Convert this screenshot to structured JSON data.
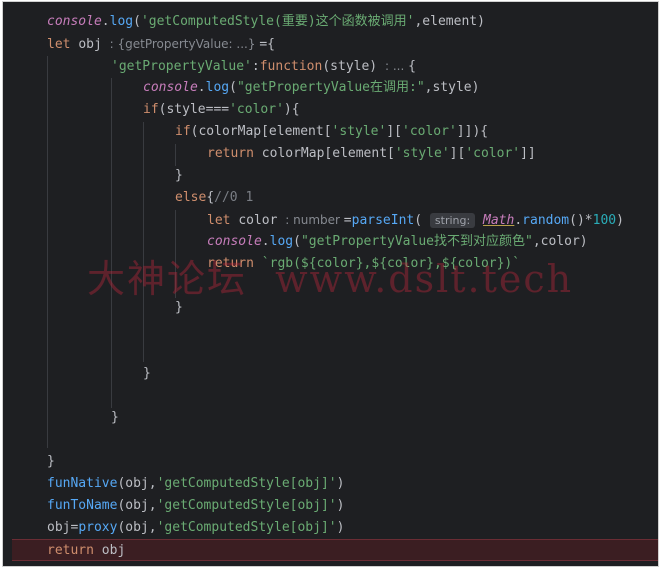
{
  "lines": {
    "l1": {
      "a": "console",
      "b": ".",
      "c": "log",
      "d": "(",
      "e": "'getComputedStyle(重要)这个函数被调用'",
      "f": ",element)"
    },
    "l2": {
      "a": "let ",
      "b": "obj ",
      "hint": ": {getPropertyValue: ...} ",
      "c": "={"
    },
    "l3": {
      "a": "'getPropertyValue'",
      "b": ":",
      "c": "function",
      "d": "(style) ",
      "hint": ": ... ",
      "e": "{"
    },
    "l4": {
      "a": "console",
      "b": ".",
      "c": "log",
      "d": "(",
      "e": "\"getPropertyValue在调用:\"",
      "f": ",style)"
    },
    "l5": {
      "a": "if",
      "b": "(style===",
      "c": "'color'",
      "d": "){"
    },
    "l6": {
      "a": "if",
      "b": "(colorMap[element[",
      "c": "'style'",
      "d": "][",
      "e": "'color'",
      "f": "]]){"
    },
    "l7": {
      "a": "return ",
      "b": "colorMap[element[",
      "c": "'style'",
      "d": "][",
      "e": "'color'",
      "f": "]]"
    },
    "l8": {
      "a": "}"
    },
    "l9": {
      "a": "else",
      "b": "{",
      "c": "//0 1"
    },
    "l10": {
      "a": "let ",
      "b": "color ",
      "hint": ": number ",
      "c": "=",
      "d": "parseInt",
      "e": "( ",
      "hint2": "string:",
      "f": " ",
      "g": "Math",
      "h": ".",
      "i": "random",
      "j": "()*",
      "k": "100",
      "l": ")"
    },
    "l11": {
      "a": "console",
      "b": ".",
      "c": "log",
      "d": "(",
      "e": "\"getPropertyValue找不到对应颜色\"",
      "f": ",color)"
    },
    "l12": {
      "a": "return ",
      "b": "`rgb(${color},${color},${color})`"
    },
    "l13": {
      "a": "}"
    },
    "l14": {
      "a": "}"
    },
    "l15": {
      "a": "}"
    },
    "l16": {
      "a": "}"
    },
    "l17": {
      "a": "funNative",
      "b": "(obj,",
      "c": "'getComputedStyle[obj]'",
      "d": ")"
    },
    "l18": {
      "a": "funToName",
      "b": "(obj,",
      "c": "'getComputedStyle[obj]'",
      "d": ")"
    },
    "l19": {
      "a": "obj=",
      "b": "proxy",
      "c": "(obj,",
      "d": "'getComputedStyle[obj]'",
      "e": ")"
    },
    "l20": {
      "a": "return ",
      "b": "obj"
    }
  },
  "watermark": "大神论坛  www.dslt.tech",
  "colors": {
    "background": "#1e1f22",
    "keyword": "#cf8e6d",
    "string": "#6aab73",
    "function": "#56a8f5",
    "italic": "#c77dbb",
    "number": "#2aacb8",
    "highlight": "#3b1e22"
  }
}
